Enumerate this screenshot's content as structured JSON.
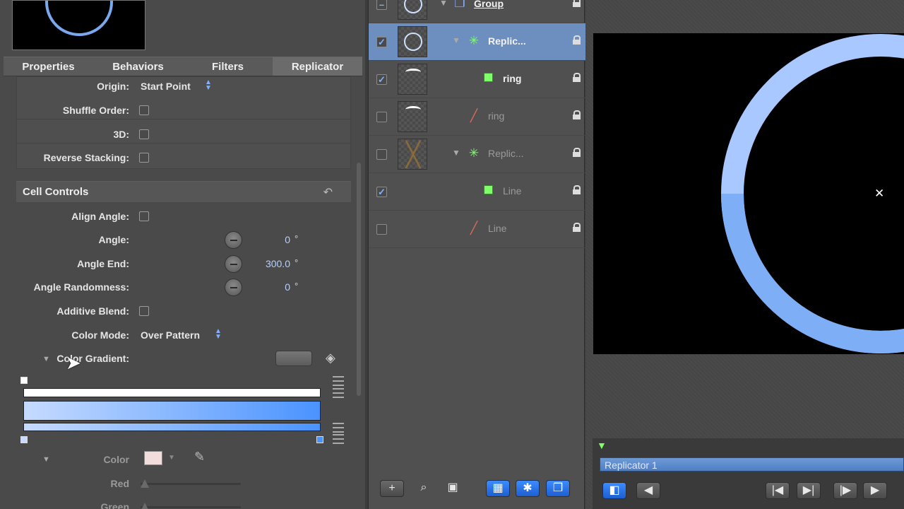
{
  "inspector": {
    "tabs": [
      {
        "label": "Properties"
      },
      {
        "label": "Behaviors"
      },
      {
        "label": "Filters"
      },
      {
        "label": "Replicator"
      }
    ],
    "rows": {
      "origin": {
        "label": "Origin:",
        "value": "Start Point"
      },
      "shuffle": {
        "label": "Shuffle Order:"
      },
      "threed": {
        "label": "3D:"
      },
      "reverse": {
        "label": "Reverse Stacking:"
      }
    },
    "cell_controls": {
      "title": "Cell Controls",
      "align_angle": {
        "label": "Align Angle:"
      },
      "angle": {
        "label": "Angle:",
        "value": "0",
        "unit": "°"
      },
      "angle_end": {
        "label": "Angle End:",
        "value": "300.0",
        "unit": "°"
      },
      "angle_randomness": {
        "label": "Angle Randomness:",
        "value": "0",
        "unit": "°"
      },
      "additive_blend": {
        "label": "Additive Blend:"
      },
      "color_mode": {
        "label": "Color Mode:",
        "value": "Over Pattern"
      },
      "color_gradient": {
        "label": "Color Gradient:"
      },
      "color": {
        "label": "Color"
      },
      "red": {
        "label": "Red"
      },
      "green": {
        "label": "Green"
      }
    },
    "colors": {
      "gradient_start": "#c6dbff",
      "gradient_end": "#4a93ff"
    }
  },
  "layers": [
    {
      "name": "Group",
      "checked": "partial",
      "thumb": "ring",
      "icon": "group-icon"
    },
    {
      "name": "Replic...",
      "checked": true,
      "selected": true,
      "thumb": "ring",
      "icon": "replicator-icon"
    },
    {
      "name": "ring",
      "checked": true,
      "thumb": "arc",
      "icon": "shape-icon"
    },
    {
      "name": "ring",
      "checked": false,
      "thumb": "arc",
      "icon": "line-shape-icon"
    },
    {
      "name": "Replic...",
      "checked": false,
      "thumb": "x",
      "icon": "replicator-icon"
    },
    {
      "name": "Line",
      "checked": true,
      "thumb": "none",
      "icon": "shape-icon"
    },
    {
      "name": "Line",
      "checked": false,
      "thumb": "none",
      "icon": "line-shape-icon"
    }
  ],
  "timeline": {
    "clip_label": "Replicator 1"
  },
  "canvas": {
    "ring_color": "#a9c8ff",
    "ring_dark": "#7eaef5"
  }
}
